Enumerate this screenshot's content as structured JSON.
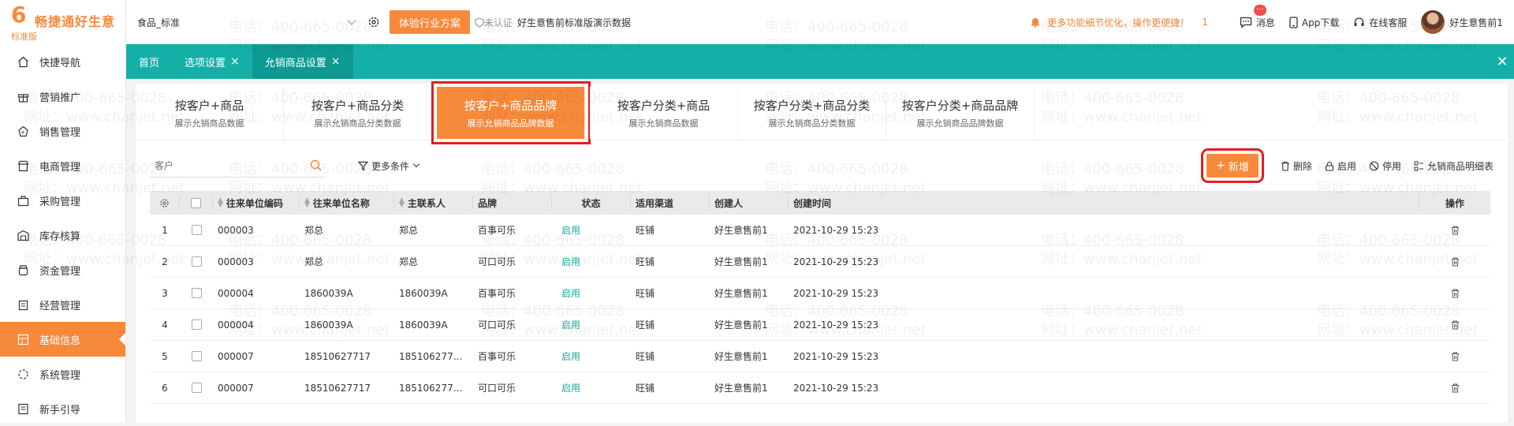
{
  "brand": {
    "name": "畅捷通好生意",
    "edition": "标准版",
    "color": "#f7893b"
  },
  "sidebar": {
    "items": [
      {
        "label": "快捷导航",
        "icon": "home-icon"
      },
      {
        "label": "营销推广",
        "icon": "gift-icon"
      },
      {
        "label": "销售管理",
        "icon": "sales-icon"
      },
      {
        "label": "电商管理",
        "icon": "shop-icon"
      },
      {
        "label": "采购管理",
        "icon": "bag-icon"
      },
      {
        "label": "库存核算",
        "icon": "warehouse-icon"
      },
      {
        "label": "资金管理",
        "icon": "money-icon"
      },
      {
        "label": "经营管理",
        "icon": "clipboard-icon"
      },
      {
        "label": "基础信息",
        "icon": "grid-icon",
        "active": true
      },
      {
        "label": "系统管理",
        "icon": "system-icon"
      },
      {
        "label": "新手引导",
        "icon": "guide-icon"
      }
    ]
  },
  "topbar": {
    "account": "食品_标准",
    "experience_button": "体验行业方案",
    "unverified": "未认证",
    "company": "好生意售前标准版演示数据",
    "notice": "更多功能细节优化，操作更便捷！",
    "notice_count": "1",
    "messages": "消息",
    "messages_badge": "···",
    "app_download": "App下载",
    "online_service": "在线客服",
    "user": "好生意售前1"
  },
  "tabs": [
    {
      "label": "首页",
      "closable": false
    },
    {
      "label": "选项设置",
      "closable": true
    },
    {
      "label": "允销商品设置",
      "closable": true,
      "active": true
    }
  ],
  "categories": [
    {
      "title": "按客户+商品",
      "subtitle": "展示允销商品数据"
    },
    {
      "title": "按客户+商品分类",
      "subtitle": "展示允销商品分类数据"
    },
    {
      "title": "按客户+商品品牌",
      "subtitle": "展示允销商品品牌数据",
      "active": true
    },
    {
      "title": "按客户分类+商品",
      "subtitle": "展示允销商品数据"
    },
    {
      "title": "按客户分类+商品分类",
      "subtitle": "展示允销商品分类数据"
    },
    {
      "title": "按客户分类+商品品牌",
      "subtitle": "展示允销商品品牌数据"
    }
  ],
  "toolbar": {
    "search_placeholder": "客户",
    "more_filters": "更多条件",
    "add": "新增",
    "delete": "删除",
    "enable": "启用",
    "disable": "停用",
    "detail": "允销商品明细表"
  },
  "table": {
    "headers": {
      "code": "往来单位编码",
      "name": "往来单位名称",
      "contact": "主联系人",
      "brand": "品牌",
      "status": "状态",
      "channel": "适用渠道",
      "creator": "创建人",
      "created": "创建时间",
      "ops": "操作"
    },
    "rows": [
      {
        "no": "1",
        "code": "000003",
        "name": "郑总",
        "contact": "郑总",
        "brand": "百事可乐",
        "status": "启用",
        "channel": "旺铺",
        "creator": "好生意售前1",
        "created": "2021-10-29 15:23"
      },
      {
        "no": "2",
        "code": "000003",
        "name": "郑总",
        "contact": "郑总",
        "brand": "可口可乐",
        "status": "启用",
        "channel": "旺铺",
        "creator": "好生意售前1",
        "created": "2021-10-29 15:23"
      },
      {
        "no": "3",
        "code": "000004",
        "name": "1860039A",
        "contact": "1860039A",
        "brand": "百事可乐",
        "status": "启用",
        "channel": "旺铺",
        "creator": "好生意售前1",
        "created": "2021-10-29 15:23"
      },
      {
        "no": "4",
        "code": "000004",
        "name": "1860039A",
        "contact": "1860039A",
        "brand": "可口可乐",
        "status": "启用",
        "channel": "旺铺",
        "creator": "好生意售前1",
        "created": "2021-10-29 15:23"
      },
      {
        "no": "5",
        "code": "000007",
        "name": "18510627717",
        "contact": "185106277...",
        "brand": "百事可乐",
        "status": "启用",
        "channel": "旺铺",
        "creator": "好生意售前1",
        "created": "2021-10-29 15:23"
      },
      {
        "no": "6",
        "code": "000007",
        "name": "18510627717",
        "contact": "185106277...",
        "brand": "可口可乐",
        "status": "启用",
        "channel": "旺铺",
        "creator": "好生意售前1",
        "created": "2021-10-29 15:23"
      }
    ]
  },
  "watermark": {
    "phone": "电话：400-665-0028",
    "site": "网址：www.chanjet.net"
  }
}
